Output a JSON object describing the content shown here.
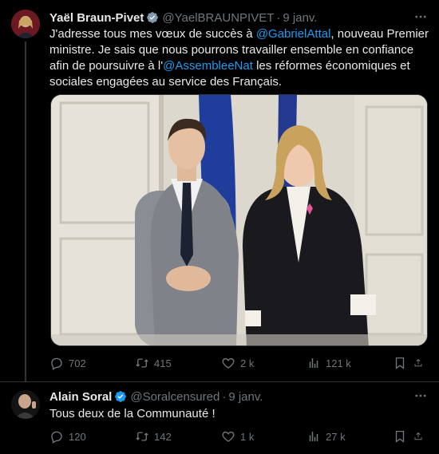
{
  "tweet1": {
    "name": "Yaël Braun-Pivet",
    "handle": "@YaelBRAUNPIVET",
    "date": "9 janv.",
    "text_parts": [
      "J'adresse tous mes vœux de succès à ",
      "@GabrielAttal",
      ", nouveau Premier ministre. Je sais que nous pourrons travailler ensemble en confiance afin de poursuivre à l'",
      "@AssembleeNat",
      " les réformes économiques et sociales engagées au service des Français."
    ],
    "replies": "702",
    "retweets": "415",
    "likes": "2 k",
    "views": "121 k"
  },
  "tweet2": {
    "name": "Alain Soral",
    "handle": "@Soralcensured",
    "date": "9 janv.",
    "text": "Tous deux de la Communauté !",
    "replies": "120",
    "retweets": "142",
    "likes": "1 k",
    "views": "27 k"
  },
  "colors": {
    "background": "#000000",
    "text": "#e7e9ea",
    "muted": "#71767b",
    "link": "#1d9bf0",
    "verified": "#1d9bf0"
  },
  "icons": [
    "verified-badge-icon",
    "more-icon",
    "reply-icon",
    "retweet-icon",
    "like-icon",
    "views-icon",
    "bookmark-icon",
    "share-icon"
  ]
}
